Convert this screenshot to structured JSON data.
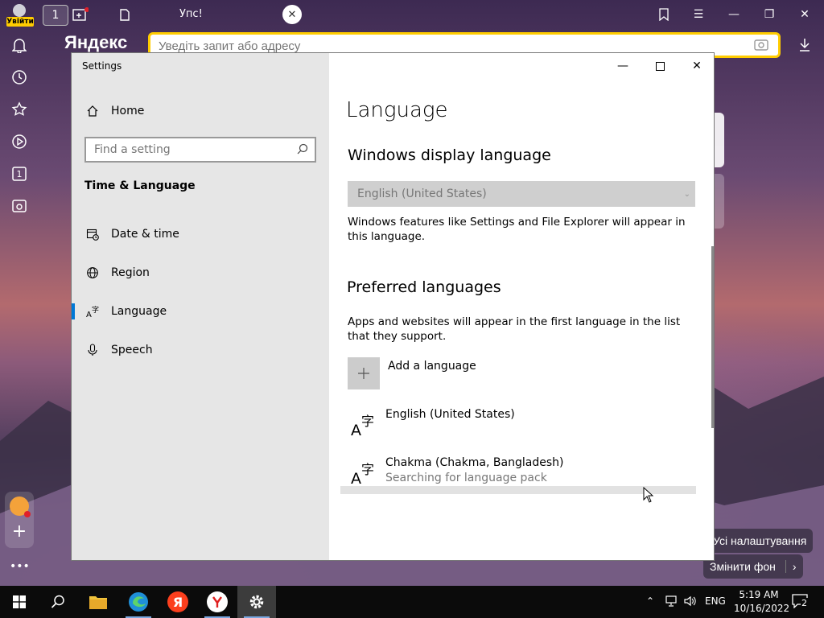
{
  "browser": {
    "login_label": "Увійти",
    "tab_count": "1",
    "tab_title": "Упс!",
    "logo": "Яндекс",
    "address_placeholder": "Уведіть запит або адресу",
    "sidebar_badge": "1",
    "all_settings_label": "Усі налаштування",
    "change_bg_label": "Змінити фон",
    "accent": "#ffcc00"
  },
  "settings": {
    "window_title": "Settings",
    "nav": {
      "home": "Home",
      "search_placeholder": "Find a setting",
      "section": "Time & Language",
      "items": [
        {
          "label": "Date & time",
          "icon": "calendar-clock-icon"
        },
        {
          "label": "Region",
          "icon": "globe-icon"
        },
        {
          "label": "Language",
          "icon": "language-icon",
          "active": true
        },
        {
          "label": "Speech",
          "icon": "microphone-icon"
        }
      ]
    },
    "page": {
      "title": "Language",
      "display_heading": "Windows display language",
      "display_value": "English (United States)",
      "display_desc": "Windows features like Settings and File Explorer will appear in this language.",
      "preferred_heading": "Preferred languages",
      "preferred_desc": "Apps and websites will appear in the first language in the list that they support.",
      "add_language": "Add a language",
      "languages": [
        {
          "name": "English (United States)",
          "status": ""
        },
        {
          "name": "Chakma (Chakma, Bangladesh)",
          "status": "Searching for language pack"
        }
      ]
    },
    "accent": "#0078d7"
  },
  "taskbar": {
    "language": "ENG",
    "time": "5:19 AM",
    "date": "10/16/2022",
    "notifications": "2"
  }
}
